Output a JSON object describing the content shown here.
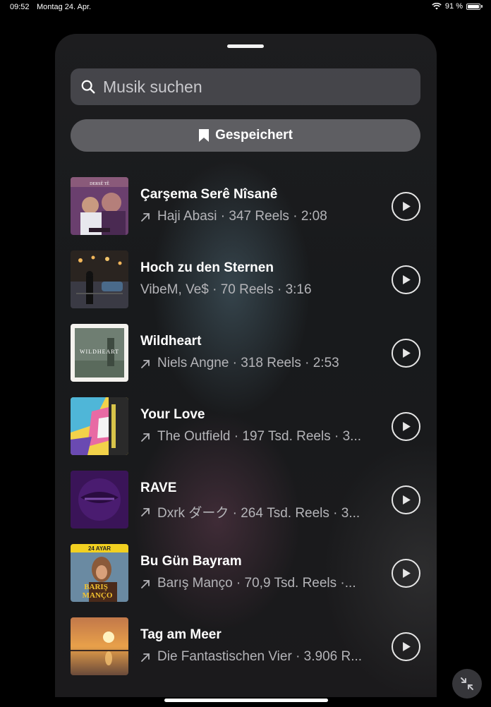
{
  "status": {
    "time": "09:52",
    "date": "Montag 24. Apr.",
    "battery": "91 %"
  },
  "search": {
    "placeholder": "Musik suchen"
  },
  "saved": {
    "label": "Gespeichert"
  },
  "tracks": [
    {
      "title": "Çarşema Serê Nîsanê",
      "meta": "Haji Abasi · 347 Reels · 2:08",
      "trending": true
    },
    {
      "title": "Hoch zu den Sternen",
      "meta": "VibeM, Ve$ · 70 Reels · 3:16",
      "trending": false
    },
    {
      "title": "Wildheart",
      "meta": "Niels Angne · 318 Reels · 2:53",
      "trending": true
    },
    {
      "title": "Your Love",
      "meta": "The Outfield · 197 Tsd. Reels · 3...",
      "trending": true
    },
    {
      "title": "RAVE",
      "meta": "Dxrk ダーク · 264 Tsd. Reels · 3...",
      "trending": true
    },
    {
      "title": "Bu Gün Bayram",
      "meta": "Barış Manço · 70,9 Tsd. Reels ·...",
      "trending": true
    },
    {
      "title": "Tag am Meer",
      "meta": "Die Fantastischen Vier · 3.906 R...",
      "trending": true
    }
  ],
  "covers": {
    "c0": {
      "top": "DERSÊ TÊ"
    },
    "c2": {
      "top": "WILDHEART"
    },
    "c5": {
      "top": "24 AYAR",
      "name1": "BARIŞ",
      "name2": "MANÇO"
    }
  },
  "colors": {
    "accent_text": "#ffffff",
    "secondary_text": "#b4b4b8"
  }
}
